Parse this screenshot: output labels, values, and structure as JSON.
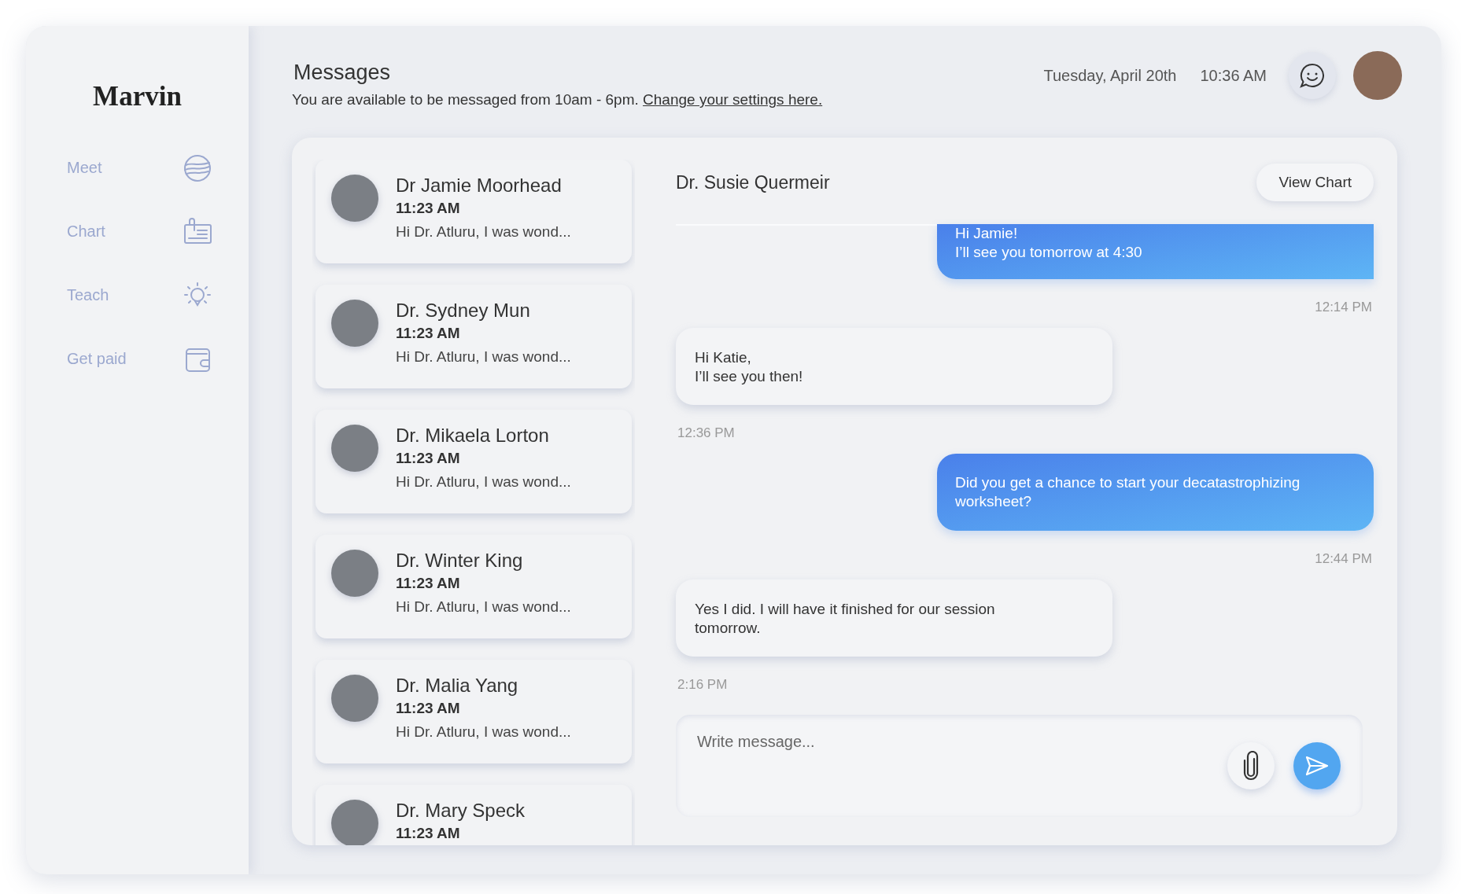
{
  "logo": "Marvin",
  "sidebar": {
    "items": [
      {
        "label": "Meet",
        "kind": "planet"
      },
      {
        "label": "Chart",
        "kind": "clipboard"
      },
      {
        "label": "Teach",
        "kind": "bulb"
      },
      {
        "label": "Get paid",
        "kind": "wallet"
      }
    ]
  },
  "header": {
    "title": "Messages",
    "availability": "You are available to be messaged from 10am - 6pm.",
    "settings_link": "Change your settings here.",
    "date": "Tuesday, April 20th",
    "time": "10:36 AM"
  },
  "conversations": [
    {
      "name": "Dr Jamie Moorhead",
      "time": "11:23 AM",
      "preview": "Hi Dr. Atluru,  I was wond..."
    },
    {
      "name": "Dr. Sydney Mun",
      "time": "11:23 AM",
      "preview": "Hi Dr. Atluru,  I was wond..."
    },
    {
      "name": "Dr. Mikaela Lorton",
      "time": "11:23 AM",
      "preview": "Hi Dr. Atluru,  I was wond..."
    },
    {
      "name": "Dr. Winter King",
      "time": "11:23 AM",
      "preview": "Hi Dr. Atluru,  I was wond..."
    },
    {
      "name": "Dr. Malia Yang",
      "time": "11:23 AM",
      "preview": "Hi Dr. Atluru,  I was wond..."
    },
    {
      "name": "Dr. Mary Speck",
      "time": "11:23 AM"
    }
  ],
  "chat": {
    "contact": "Dr. Susie Quermeir",
    "button": "View Chart",
    "messages": [
      {
        "kind": "sent",
        "text": "Hi Jamie!\nI’ll see you tomorrow at 4:30",
        "time": "12:14 PM"
      },
      {
        "kind": "received",
        "text": "Hi Katie,\nI’ll see you then!",
        "time": "12:36 PM"
      },
      {
        "kind": "sent",
        "text": "Did you get a chance to start your decatastrophizing worksheet?",
        "time": "12:44 PM"
      },
      {
        "kind": "received",
        "text": "Yes I did.  I will have it finished for our session tomorrow.",
        "time": "2:16 PM"
      }
    ],
    "compose": {
      "placeholder": "Write message..."
    }
  }
}
